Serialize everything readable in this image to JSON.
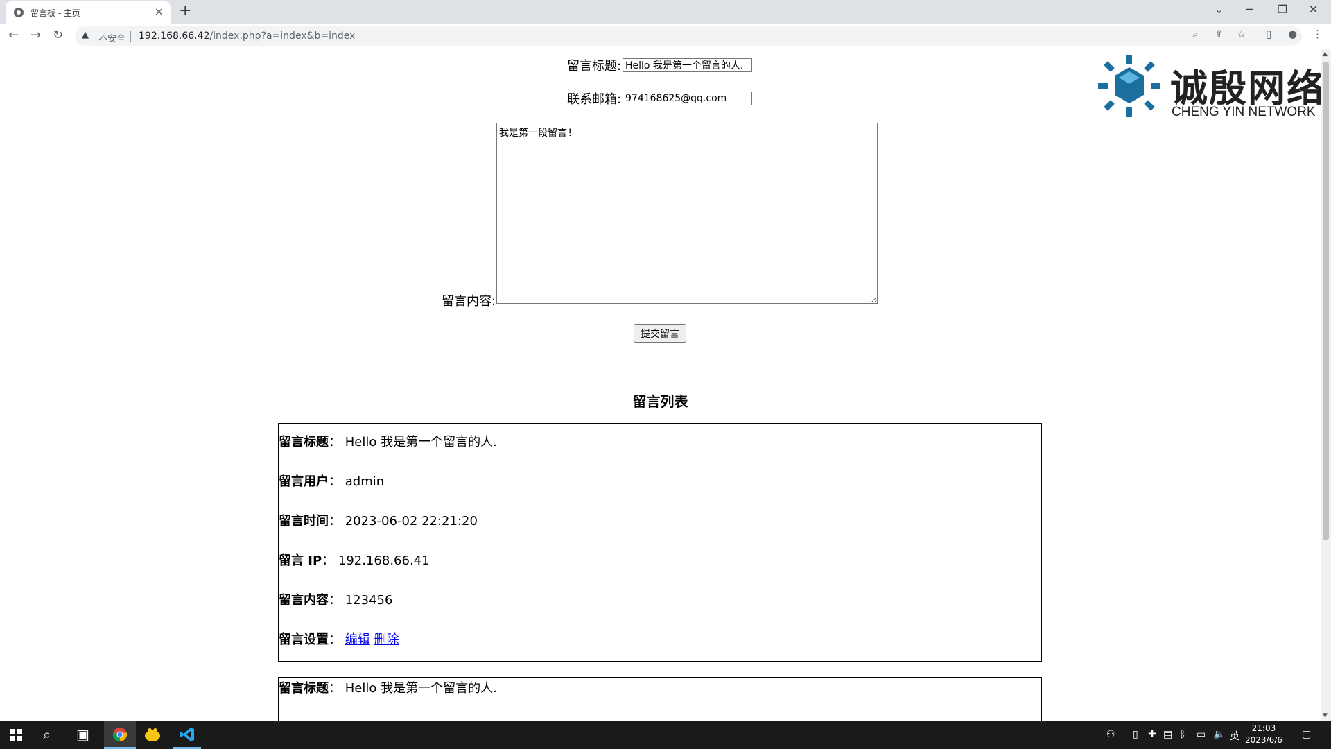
{
  "browser": {
    "tab_title": "留言板 - 主页",
    "tab_close": "×",
    "new_tab": "+",
    "not_secure": "不安全",
    "url_host": "192.168.66.42",
    "url_path": "/index.php?a=index&b=index"
  },
  "form": {
    "title_label": "留言标题:",
    "title_value": "Hello 我是第一个留言的人.",
    "email_label": "联系邮箱:",
    "email_value": "974168625@qq.com",
    "content_label": "留言内容:",
    "content_value": "我是第一段留言!",
    "submit_label": "提交留言"
  },
  "logo": {
    "cn": "诚殷网络",
    "en": "CHENG YIN NETWORK"
  },
  "list": {
    "title": "留言列表",
    "entries": [
      {
        "title_label": "留言标题",
        "title": "Hello 我是第一个留言的人.",
        "user_label": "留言用户",
        "user": "admin",
        "time_label": "留言时间",
        "time": "2023-06-02 22:21:20",
        "ip_label": "留言 IP",
        "ip": "192.168.66.41",
        "content_label": "留言内容",
        "content": "123456",
        "settings_label": "留言设置",
        "edit": "编辑",
        "delete": "删除"
      },
      {
        "title_label": "留言标题",
        "title": "Hello 我是第一个留言的人."
      }
    ]
  },
  "taskbar": {
    "time": "21:03",
    "date": "2023/6/6",
    "ime": "英"
  }
}
